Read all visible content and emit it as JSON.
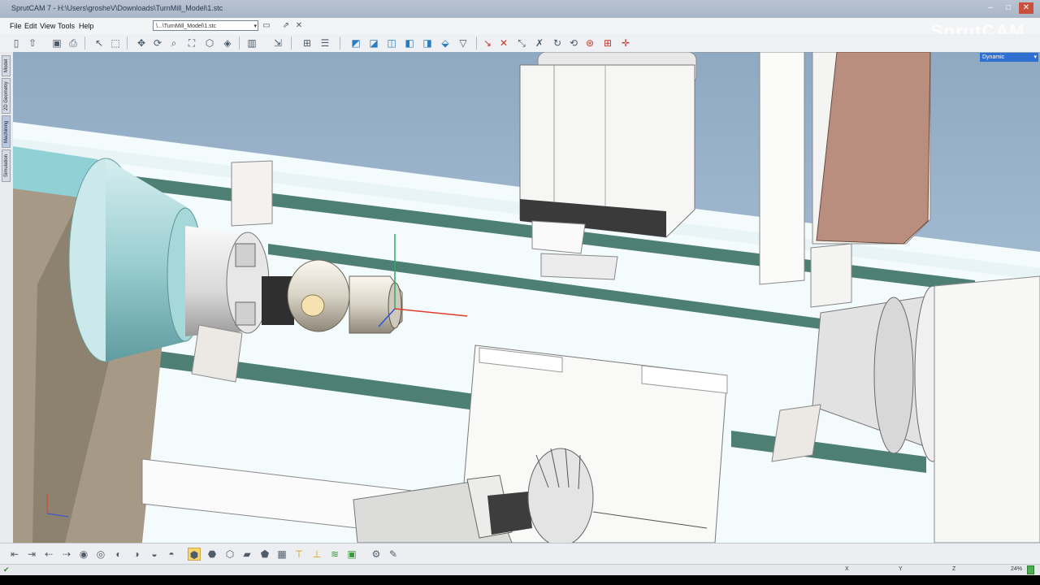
{
  "window": {
    "title": "SprutCAM 7 - H:\\Users\\grosheV\\Downloads\\TurnMill_Model\\1.stc",
    "minimize": "–",
    "maximize": "□",
    "close": "✕"
  },
  "brand": "SprutCAM",
  "menu": [
    "File",
    "Edit",
    "View",
    "Tools",
    "Help"
  ],
  "path_combo": {
    "value": "\\...\\TurnMill_Model\\1.stc"
  },
  "view_mode": {
    "value": "Dynamic",
    "options": [
      "Dynamic"
    ]
  },
  "side_tabs": [
    "Model",
    "2D Geometry",
    "Machining",
    "Simulation"
  ],
  "toolbar_icons": [
    "new-icon",
    "open-icon",
    "save-icon",
    "print-icon",
    "select-icon",
    "select-box-icon",
    "pan-icon",
    "rotate-icon",
    "zoom-icon",
    "zoom-fit-icon",
    "view-iso-icon",
    "view-top-icon",
    "layers-icon",
    "arrow-icon",
    "table-icon",
    "list-icon",
    "machine-icon",
    "axis-x-icon",
    "axis-y-icon",
    "axis-z-icon",
    "axis-xyz-icon",
    "tool-icon",
    "measure-icon",
    "snap-icon",
    "line-icon",
    "move-icon",
    "rotate-part-icon",
    "transform-icon",
    "grid-icon"
  ],
  "bottom_icons": [
    "view-front-icon",
    "view-back-icon",
    "view-left-icon",
    "view-right-icon",
    "view-top-icon",
    "view-bottom-icon",
    "view-iso1-icon",
    "view-iso2-icon",
    "view-iso3-icon",
    "shaded-icon",
    "shaded-edges-icon",
    "wireframe-icon",
    "hidden-icon",
    "solid-icon",
    "section-icon",
    "toolpath-icon",
    "toolpath-color-icon",
    "stock-icon",
    "workpiece-icon",
    "machine-view-icon",
    "settings-icon"
  ],
  "status": {
    "x_label": "X",
    "y_label": "Y",
    "z_label": "Z",
    "zoom": "24%"
  },
  "colors": {
    "floor": "#f4fbfd",
    "rail": "#4e7f74",
    "spindle": "#a9d6d8",
    "head": "#b98e7e",
    "machine_body": "#f3f3f1",
    "tool_block": "#3a3a3a",
    "part": "#d8d3c8",
    "sky": "#9ab4cc"
  }
}
